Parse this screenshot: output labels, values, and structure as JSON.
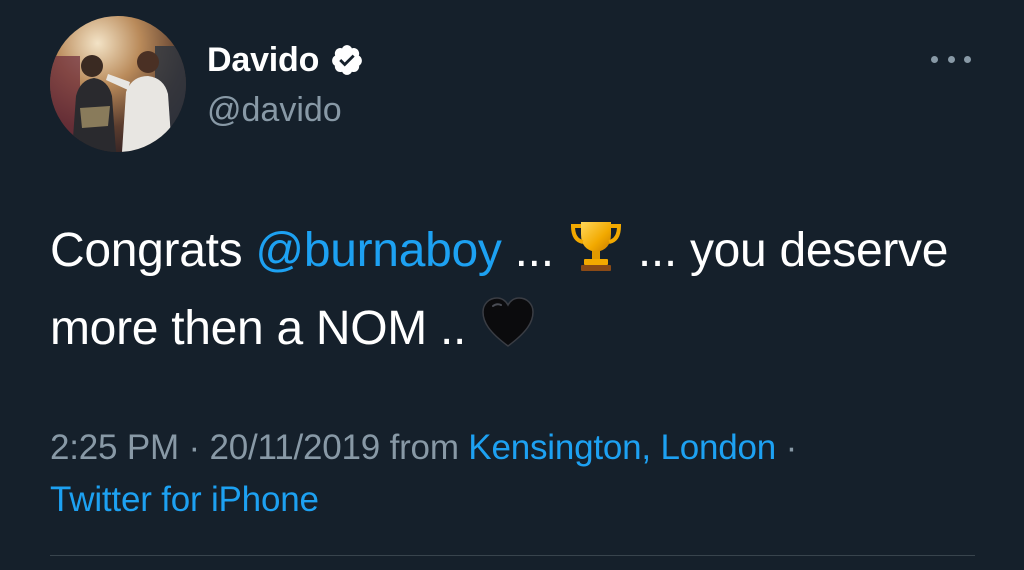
{
  "author": {
    "display_name": "Davido",
    "handle": "@davido",
    "verified": true
  },
  "tweet": {
    "text_part1": "Congrats ",
    "mention": "@burnaboy",
    "text_part2": " ... ",
    "emoji1": "trophy",
    "text_part3": " ... you deserve more then a NOM .. ",
    "emoji2": "black-heart"
  },
  "meta": {
    "time": "2:25 PM",
    "separator": " · ",
    "date": "20/11/2019",
    "from_label": " from ",
    "location": "Kensington, London",
    "source": "Twitter for iPhone"
  },
  "colors": {
    "background": "#15202b",
    "link": "#1da1f2",
    "secondary_text": "#8899a6"
  },
  "icons": {
    "verified": "verified-badge-icon",
    "more": "more-options-icon"
  }
}
